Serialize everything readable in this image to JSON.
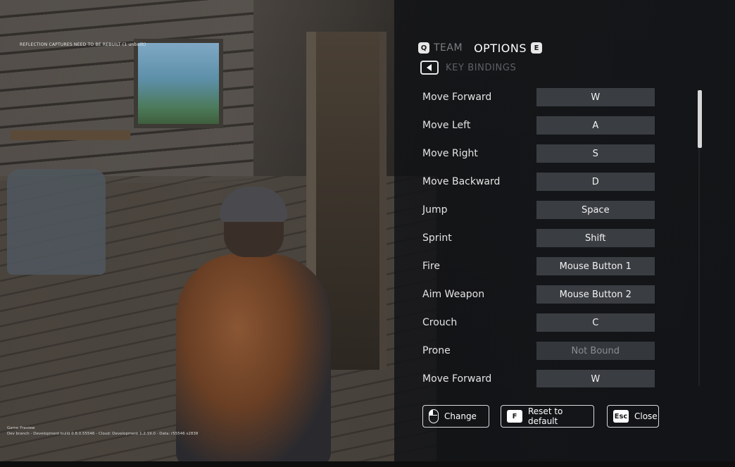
{
  "hud": {
    "dev_warning": "REFLECTION CAPTURES NEED TO BE REBUILT (1 unbuilt)",
    "build_line1": "Game Preview",
    "build_line2": "Dev branch - Development build 0.8.0.55546 - Cloud: Development 1.2.19.0 - Data: r55546 s2838"
  },
  "header": {
    "team_key": "Q",
    "team_label": "TEAM",
    "options_label": "OPTIONS",
    "options_key": "E"
  },
  "section": {
    "title": "KEY BINDINGS"
  },
  "bindings": [
    {
      "action": "Move Forward",
      "key": "W"
    },
    {
      "action": "Move Left",
      "key": "A"
    },
    {
      "action": "Move Right",
      "key": "S"
    },
    {
      "action": "Move Backward",
      "key": "D"
    },
    {
      "action": "Jump",
      "key": "Space"
    },
    {
      "action": "Sprint",
      "key": "Shift"
    },
    {
      "action": "Fire",
      "key": "Mouse Button 1"
    },
    {
      "action": "Aim Weapon",
      "key": "Mouse Button 2"
    },
    {
      "action": "Crouch",
      "key": "C"
    },
    {
      "action": "Prone",
      "key": "Not Bound"
    },
    {
      "action": "Move Forward",
      "key": "W"
    }
  ],
  "footer": {
    "change_label": "Change",
    "reset_key": "F",
    "reset_label": "Reset to default",
    "close_key": "Esc",
    "close_label": "Close"
  },
  "icons": {
    "back": "chevron-left-icon",
    "change": "mouse-icon"
  },
  "colors": {
    "panel_bg": "#121417",
    "key_slot": "#3a3d42",
    "text": "#e4e4e4",
    "muted": "#5e6064"
  }
}
